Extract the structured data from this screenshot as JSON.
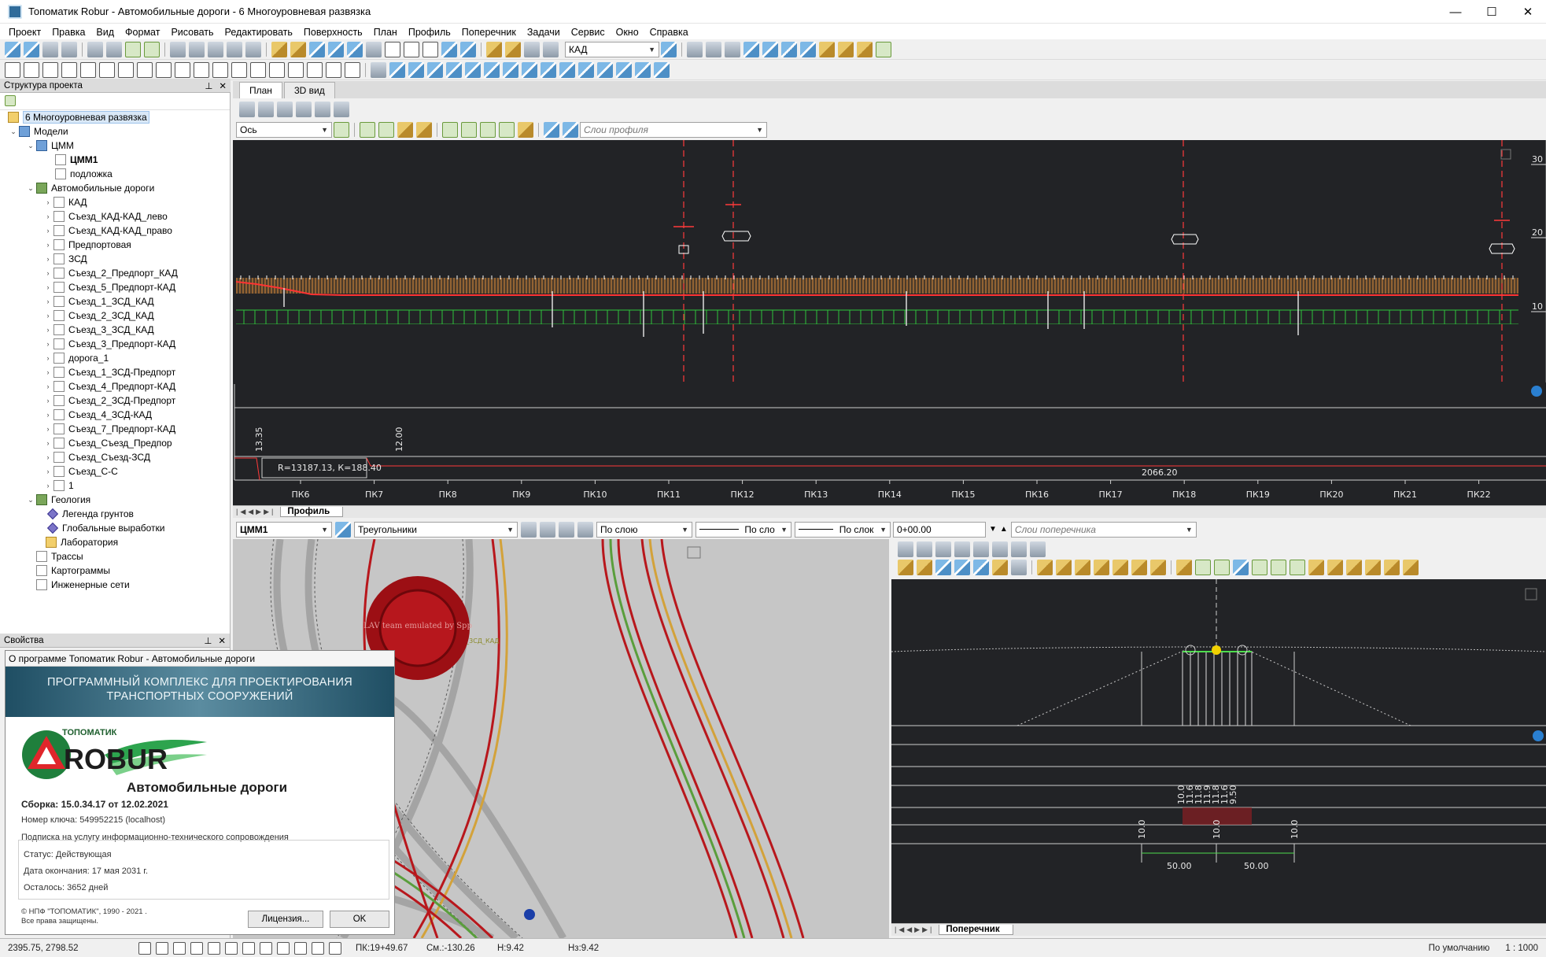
{
  "window": {
    "title": "Топоматик Robur - Автомобильные дороги - 6 Многоуровневая развязка",
    "minimize": "—",
    "maximize": "☐",
    "close": "✕"
  },
  "menu": [
    "Проект",
    "Правка",
    "Вид",
    "Формат",
    "Рисовать",
    "Редактировать",
    "Поверхность",
    "План",
    "Профиль",
    "Поперечник",
    "Задачи",
    "Сервис",
    "Окно",
    "Справка"
  ],
  "toolbar": {
    "layer_combo": "КАД"
  },
  "project_panel": {
    "title": "Структура проекта",
    "pin": "⊥",
    "close": "✕",
    "root": "6 Многоуровневая развязка",
    "models": "Модели",
    "dtm_group": "ЦММ",
    "dtm1": "ЦММ1",
    "underlay": "подложка",
    "roads_group": "Автомобильные дороги",
    "roads": [
      "КАД",
      "Съезд_КАД-КАД_лево",
      "Съезд_КАД-КАД_право",
      "Предпортовая",
      "ЗСД",
      "Съезд_2_Предпорт_КАД",
      "Съезд_5_Предпорт-КАД",
      "Съезд_1_ЗСД_КАД",
      "Съезд_2_ЗСД_КАД",
      "Съезд_3_ЗСД_КАД",
      "Съезд_3_Предпорт-КАД",
      "дорога_1",
      "Съезд_1_ЗСД-Предпорт",
      "Съезд_4_Предпорт-КАД",
      "Съезд_2_ЗСД-Предпорт",
      "Съезд_4_ЗСД-КАД",
      "Съезд_7_Предпорт-КАД",
      "Съезд_Съезд_Предпор",
      "Съезд_Съезд-ЗСД",
      "Съезд_С-С",
      "1"
    ],
    "geology": "Геология",
    "geology_items": [
      "Легенда грунтов",
      "Глобальные выработки",
      "Лаборатория"
    ],
    "other": [
      "Трассы",
      "Картограммы",
      "Инженерные сети"
    ]
  },
  "properties_panel": {
    "title": "Свойства"
  },
  "view_tabs": [
    "План",
    "3D вид"
  ],
  "profile_toolbar": {
    "axis_combo": "Ось",
    "layers_placeholder": "Слои профиля"
  },
  "profile": {
    "y_ticks": [
      "30",
      "20",
      "10"
    ],
    "elevations": [
      "13.35",
      "12.00"
    ],
    "curve_label": "R=13187.13, К=188.40",
    "length_label": "2066.20",
    "pickets": [
      "ПК6",
      "ПК7",
      "ПК8",
      "ПК9",
      "ПК10",
      "ПК11",
      "ПК12",
      "ПК13",
      "ПК14",
      "ПК15",
      "ПК16",
      "ПК17",
      "ПК18",
      "ПК19",
      "ПК20",
      "ПК21",
      "ПК22"
    ],
    "sheet_tab": "Профиль"
  },
  "plan_toolbar": {
    "surface": "ЦММ1",
    "style": "Треугольники",
    "color": "По слою",
    "line1": "По сло",
    "line2": "По слок"
  },
  "cross_toolbar": {
    "station": "0+00.00",
    "layers_placeholder": "Слои поперечника"
  },
  "cross": {
    "top_vals": [
      "10.0",
      "11.6",
      "11.8",
      "11.9",
      "11.8",
      "11.6",
      "9.50"
    ],
    "mid_vals": [
      "10.0",
      "10.0",
      "10.0"
    ],
    "widths": [
      "50.00",
      "50.00"
    ],
    "sheet_tab": "Поперечник"
  },
  "plan_overlay": {
    "watermark": "LAV team emulated by Spp",
    "road_label": "_Лп-1сьезд_1_3СД_КАД"
  },
  "about": {
    "title": "О программе Топоматик Robur - Автомобильные дороги",
    "banner_line1": "ПРОГРАММНЫЙ КОМПЛЕКС ДЛЯ ПРОЕКТИРОВАНИЯ",
    "banner_line2": "ТРАНСПОРТНЫХ СООРУЖЕНИЙ",
    "logo_top": "ТОПОМАТИК",
    "logo_main": "ROBUR",
    "product": "Автомобильные дороги",
    "build": "Сборка: 15.0.34.17 от 12.02.2021",
    "key": "Номер ключа: 549952215 (localhost)",
    "subscription": "Подписка на услугу информационно-технического сопровождения",
    "status": "Статус: Действующая",
    "end_date": "Дата окончания: 17 мая 2031 г.",
    "remaining": "Осталось: 3652 дней",
    "copyright1": "© НПФ \"ТОПОМАТИК\", 1990 - 2021 .",
    "copyright2": "Все права защищены.",
    "license_btn": "Лицензия...",
    "ok_btn": "OK"
  },
  "status": {
    "coords": "2395.75, 2798.52",
    "pk": "ПК:19+49.67",
    "offset": "См.:-130.26",
    "h": "Н:9.42",
    "hz": "Нз:9.42",
    "style": "По умолчанию",
    "scale": "1 : 1000"
  }
}
